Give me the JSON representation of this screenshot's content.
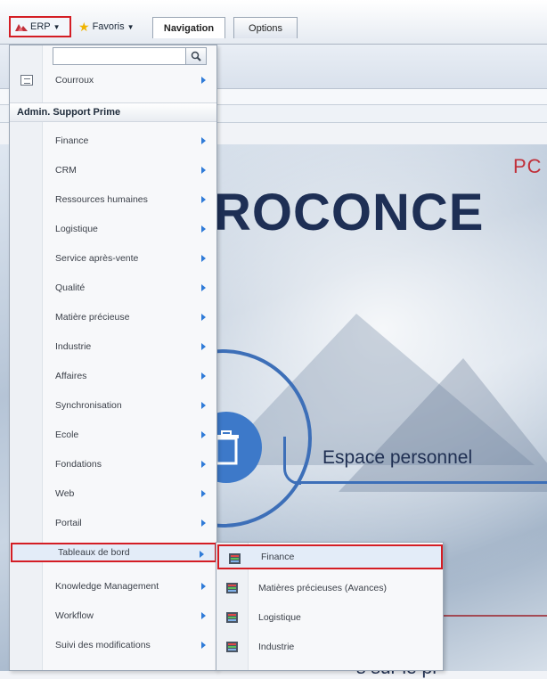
{
  "toolbar": {
    "erp_label": "ERP",
    "favoris_label": "Favoris",
    "tabs": [
      {
        "label": "Navigation",
        "active": true
      },
      {
        "label": "Options",
        "active": false
      }
    ]
  },
  "background": {
    "hero_partial_top": "PC",
    "hero_title": "ROCONCE",
    "espace_label": "Espace personnel",
    "bottom_text": "s sur le pr"
  },
  "menu": {
    "search_value": "",
    "courroux_label": "Courroux",
    "section_header": "Admin. Support Prime",
    "items": [
      {
        "label": "Finance"
      },
      {
        "label": "CRM"
      },
      {
        "label": "Ressources humaines"
      },
      {
        "label": "Logistique"
      },
      {
        "label": "Service après-vente"
      },
      {
        "label": "Qualité"
      },
      {
        "label": "Matière précieuse"
      },
      {
        "label": "Industrie"
      },
      {
        "label": "Affaires"
      },
      {
        "label": "Synchronisation"
      },
      {
        "label": "Ecole"
      },
      {
        "label": "Fondations"
      },
      {
        "label": "Web"
      },
      {
        "label": "Portail"
      },
      {
        "label": "Tableaux de bord",
        "highlighted": true
      },
      {
        "label": "Knowledge Management"
      },
      {
        "label": "Workflow"
      },
      {
        "label": "Suivi des modifications"
      }
    ]
  },
  "submenu": {
    "items": [
      {
        "label": "Finance",
        "highlighted": true
      },
      {
        "label": "Matières précieuses (Avances)"
      },
      {
        "label": "Logistique"
      },
      {
        "label": "Industrie"
      }
    ]
  },
  "colors": {
    "highlight_border": "#d41d24",
    "arrow_blue": "#2f7bd8",
    "brand_navy": "#1e2f55",
    "accent_red": "#c0303a"
  }
}
